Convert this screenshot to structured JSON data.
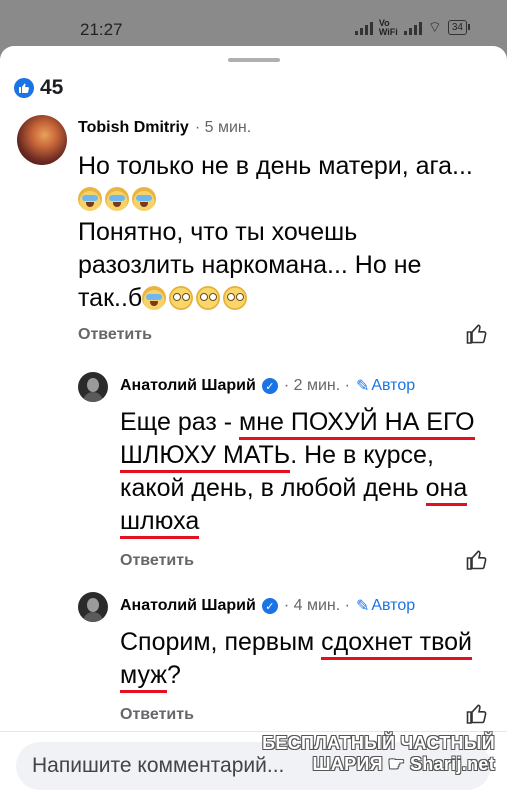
{
  "status_bar": {
    "time": "21:27",
    "volte": "Vo\nWiFi",
    "battery": "34"
  },
  "reactions": {
    "count": "45",
    "icon": "like-icon",
    "color": "#1b74e4"
  },
  "comments": [
    {
      "author": "Tobish Dmitriy",
      "time": "· 5 мин.",
      "lines": [
        "Но только не в день матери, ага...",
        "Понятно, что ты хочешь",
        "разозлить наркомана... Но не",
        "так..б"
      ],
      "reply_label": "Ответить"
    },
    {
      "author": "Анатолий Шарий",
      "verified": true,
      "time": "· 2 мин. ·",
      "badge": "Автор",
      "segments": [
        {
          "text": "Еще раз - ",
          "underline": false
        },
        {
          "text": "мне ПОХУЙ НА ЕГО",
          "underline": true
        },
        {
          "text": "ШЛЮХУ МАТЬ",
          "underline": true
        },
        {
          "text": ". Не в курсе,",
          "underline": false
        },
        {
          "text": "какой день, в любой день ",
          "underline": false
        },
        {
          "text": "она",
          "underline": true
        },
        {
          "text": "шлюха",
          "underline": true
        }
      ],
      "reply_label": "Ответить"
    },
    {
      "author": "Анатолий Шарий",
      "verified": true,
      "time": "· 4 мин. ·",
      "badge": "Автор",
      "segments": [
        {
          "text": "Спорим, первым ",
          "underline": false
        },
        {
          "text": "сдохнет твой",
          "underline": true
        },
        {
          "text": "муж",
          "underline": true
        },
        {
          "text": "?",
          "underline": false
        }
      ],
      "reply_label": "Ответить"
    }
  ],
  "composer": {
    "placeholder": "Напишите комментарий..."
  },
  "watermark": {
    "line1": "БЕСПЛАТНЫЙ ЧАСТНЫЙ",
    "line2": "ШАРИЯ",
    "line3": "Sharij.net"
  },
  "colors": {
    "accent": "#1b74e4",
    "underline": "#e4101f",
    "muted": "#65676b"
  }
}
